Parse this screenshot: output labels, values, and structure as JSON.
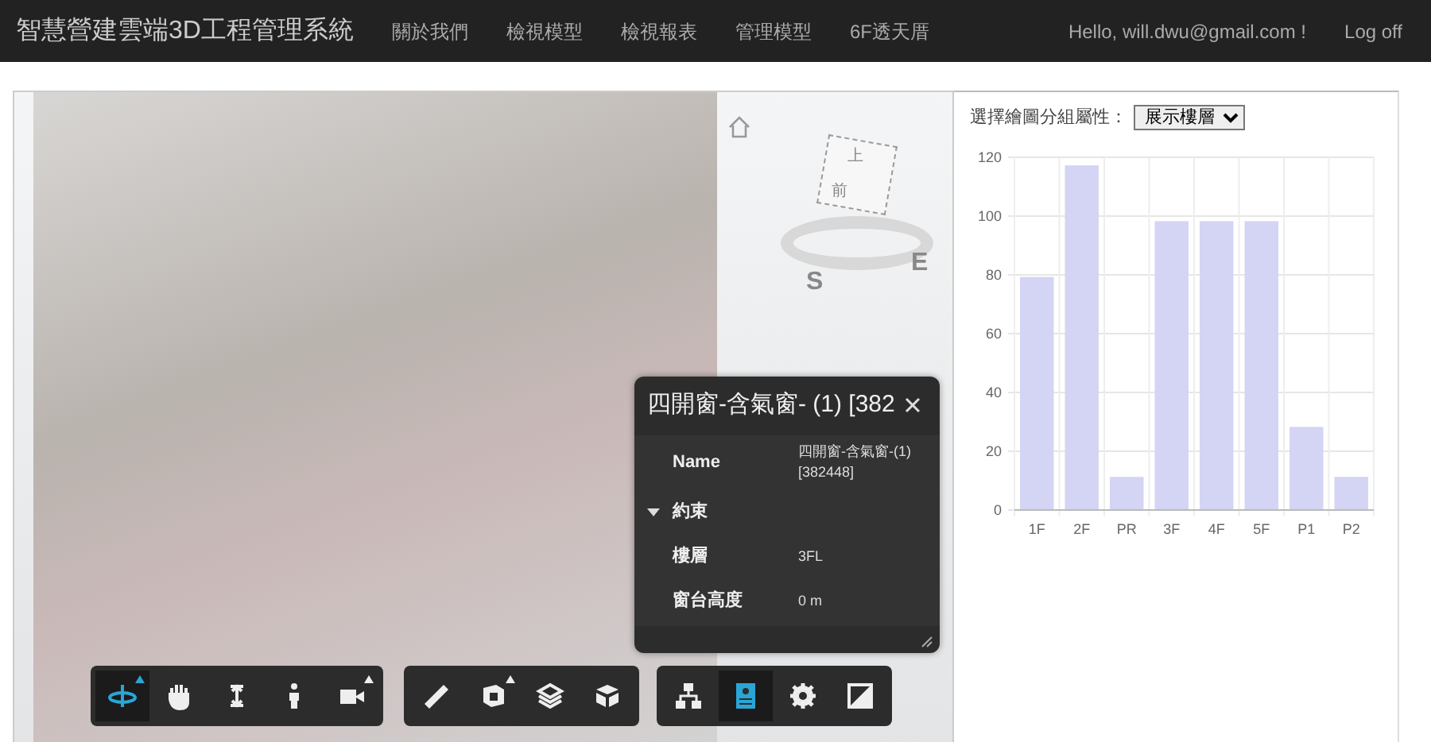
{
  "navbar": {
    "brand": "智慧營建雲端3D工程管理系統",
    "links": [
      "關於我們",
      "檢視模型",
      "檢視報表",
      "管理模型",
      "6F透天厝"
    ],
    "greeting": "Hello, will.dwu@gmail.com !",
    "logout": "Log off"
  },
  "viewer": {
    "viewcube": {
      "top": "上",
      "front": "前",
      "compass": [
        "S",
        "E"
      ]
    },
    "properties": {
      "title": "四開窗-含氣窗- (1) [382",
      "rows": [
        {
          "kind": "property",
          "label": "Name",
          "value": "四開窗-含氣窗-(1) [382448]"
        },
        {
          "kind": "category",
          "label": "約束",
          "expanded": true
        },
        {
          "kind": "property",
          "label": "樓層",
          "value": "3FL"
        },
        {
          "kind": "property",
          "label": "窗台高度",
          "value": "0 m"
        }
      ]
    },
    "toolbar": [
      [
        {
          "selected": true,
          "submenu": true
        },
        {
          "selected": false
        },
        {
          "selected": false
        },
        {
          "selected": false
        },
        {
          "selected": false,
          "submenu": true
        }
      ],
      [
        {
          "selected": false
        },
        {
          "selected": false,
          "submenu": true
        },
        {
          "selected": false
        },
        {
          "selected": false
        }
      ],
      [
        {
          "selected": false
        },
        {
          "selected": true
        },
        {
          "selected": false
        },
        {
          "selected": false
        }
      ]
    ]
  },
  "chart_panel": {
    "group_label": "選擇繪圖分組屬性：",
    "group_value": "展示樓層",
    "chart_data": {
      "type": "bar",
      "categories": [
        "1F",
        "2F",
        "PR",
        "3F",
        "4F",
        "5F",
        "P1",
        "P2"
      ],
      "series": [
        {
          "color": "#d4d4f4",
          "values": [
            79,
            117,
            11,
            98,
            98,
            98,
            28,
            11
          ]
        }
      ],
      "ylim": [
        0,
        120
      ],
      "yticks": [
        0,
        20,
        40,
        60,
        80,
        100,
        120
      ],
      "grid": true
    }
  }
}
